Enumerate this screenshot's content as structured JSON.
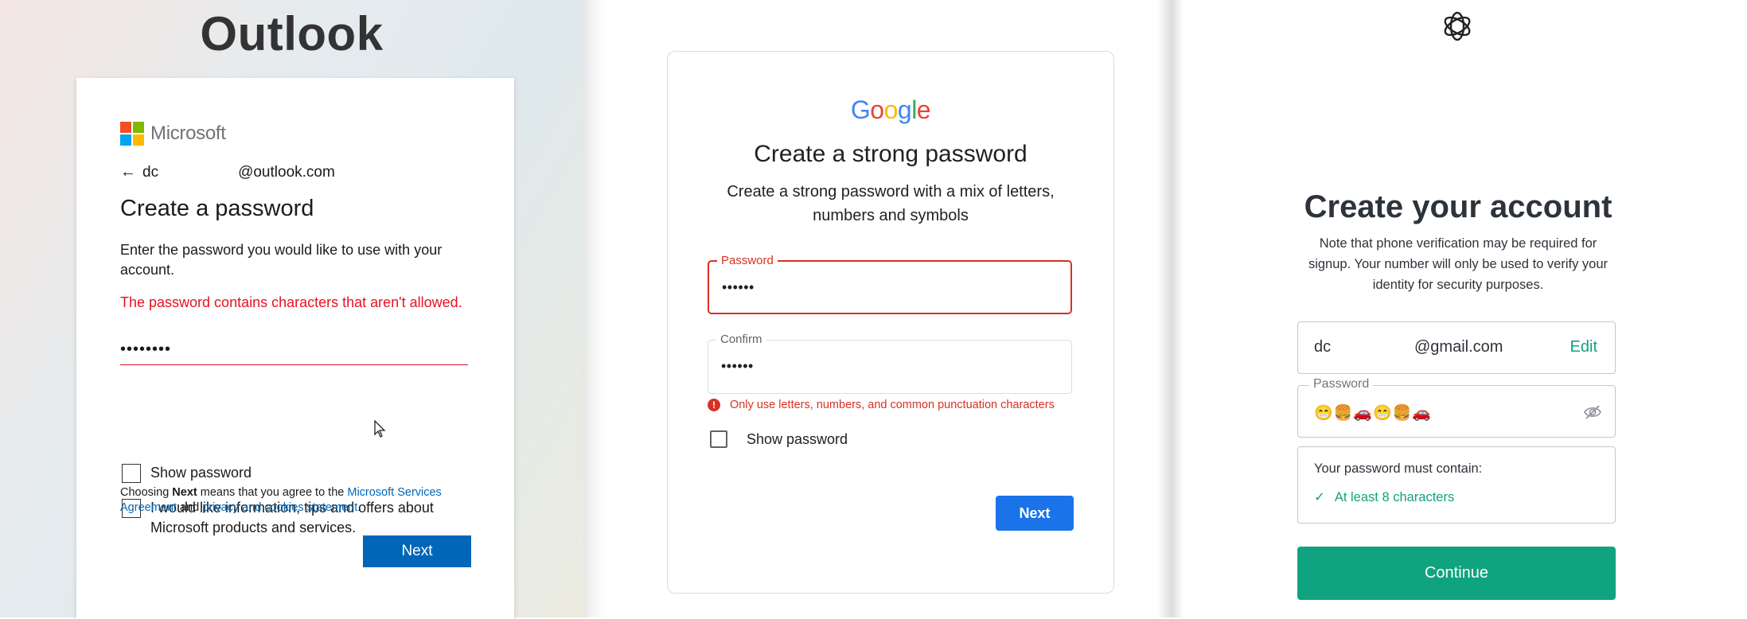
{
  "outlook": {
    "title": "Outlook",
    "brand": "Microsoft",
    "email_prefix": "dc",
    "email_domain": "@outlook.com",
    "heading": "Create a password",
    "description": "Enter the password you would like to use with your account.",
    "error": "The password contains characters that aren't allowed.",
    "password_value": "••••••••",
    "show_password_label": "Show password",
    "offers_label": "I would like information, tips and offers about Microsoft products and services.",
    "legal": {
      "pre": "Choosing ",
      "bold": "Next",
      "mid": " means that you agree to the ",
      "link1": "Microsoft Services Agreement",
      "and": " and ",
      "link2": "privacy and cookies statement",
      "end": "."
    },
    "next_label": "Next",
    "colors": {
      "accent": "#0067b8",
      "error": "#e81123"
    }
  },
  "google": {
    "logo": "Google",
    "heading": "Create a strong password",
    "subtitle": "Create a strong password with a mix of letters, numbers and symbols",
    "password_label": "Password",
    "password_value": "••••••",
    "confirm_label": "Confirm",
    "confirm_value": "••••••",
    "error": "Only use letters, numbers, and common punctuation characters",
    "show_password_label": "Show password",
    "next_label": "Next",
    "colors": {
      "accent": "#1a73e8",
      "error": "#d93025"
    }
  },
  "openai": {
    "logo_icon": "openai-logo",
    "heading": "Create your account",
    "subtitle": "Note that phone verification may be required for signup. Your number will only be used to verify your identity for security purposes.",
    "email_prefix": "dc",
    "email_domain": "@gmail.com",
    "edit_label": "Edit",
    "password_label": "Password",
    "password_value": "😁🍔🚗😁🍔🚗",
    "requirements_title": "Your password must contain:",
    "requirement_1": "At least 8 characters",
    "continue_label": "Continue",
    "colors": {
      "accent": "#10a37f"
    }
  }
}
